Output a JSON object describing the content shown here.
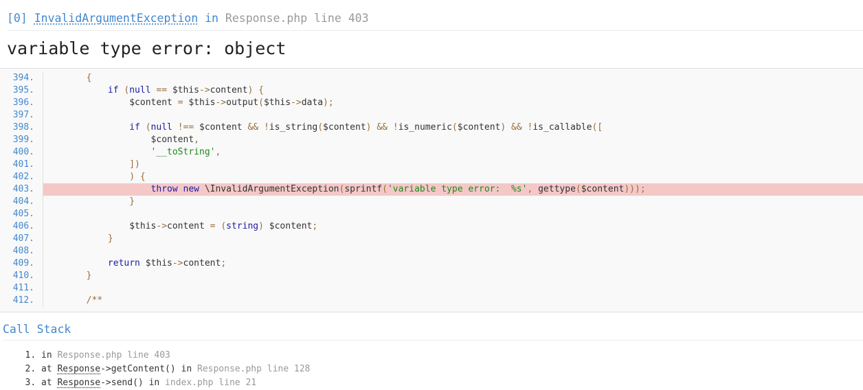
{
  "header": {
    "index": "[0]",
    "exception_class": "InvalidArgumentException",
    "in_text": "in",
    "file_text": "Response.php line 403"
  },
  "message": "variable type error:  object",
  "source": {
    "highlight_line": "403.",
    "lines": [
      {
        "num": "394.",
        "code": "    {"
      },
      {
        "num": "395.",
        "code": "        if (null == $this->content) {"
      },
      {
        "num": "396.",
        "code": "            $content = $this->output($this->data);"
      },
      {
        "num": "397.",
        "code": ""
      },
      {
        "num": "398.",
        "code": "            if (null !== $content && !is_string($content) && !is_numeric($content) && !is_callable(["
      },
      {
        "num": "399.",
        "code": "                $content,"
      },
      {
        "num": "400.",
        "code": "                '__toString',"
      },
      {
        "num": "401.",
        "code": "            ])"
      },
      {
        "num": "402.",
        "code": "            ) {"
      },
      {
        "num": "403.",
        "code": "                throw new \\InvalidArgumentException(sprintf('variable type error:  %s', gettype($content)));"
      },
      {
        "num": "404.",
        "code": "            }"
      },
      {
        "num": "405.",
        "code": ""
      },
      {
        "num": "406.",
        "code": "            $this->content = (string) $content;"
      },
      {
        "num": "407.",
        "code": "        }"
      },
      {
        "num": "408.",
        "code": ""
      },
      {
        "num": "409.",
        "code": "        return $this->content;"
      },
      {
        "num": "410.",
        "code": "    }"
      },
      {
        "num": "411.",
        "code": ""
      },
      {
        "num": "412.",
        "code": "    /**"
      }
    ]
  },
  "call_stack": {
    "title": "Call Stack",
    "items": [
      {
        "prefix": "in",
        "cls": "",
        "method": "",
        "in": "",
        "file": "Response.php line 403"
      },
      {
        "prefix": "at",
        "cls": "Response",
        "method": "->getContent()",
        "in": "in",
        "file": "Response.php line 128"
      },
      {
        "prefix": "at",
        "cls": "Response",
        "method": "->send()",
        "in": "in",
        "file": "index.php line 21"
      }
    ]
  }
}
